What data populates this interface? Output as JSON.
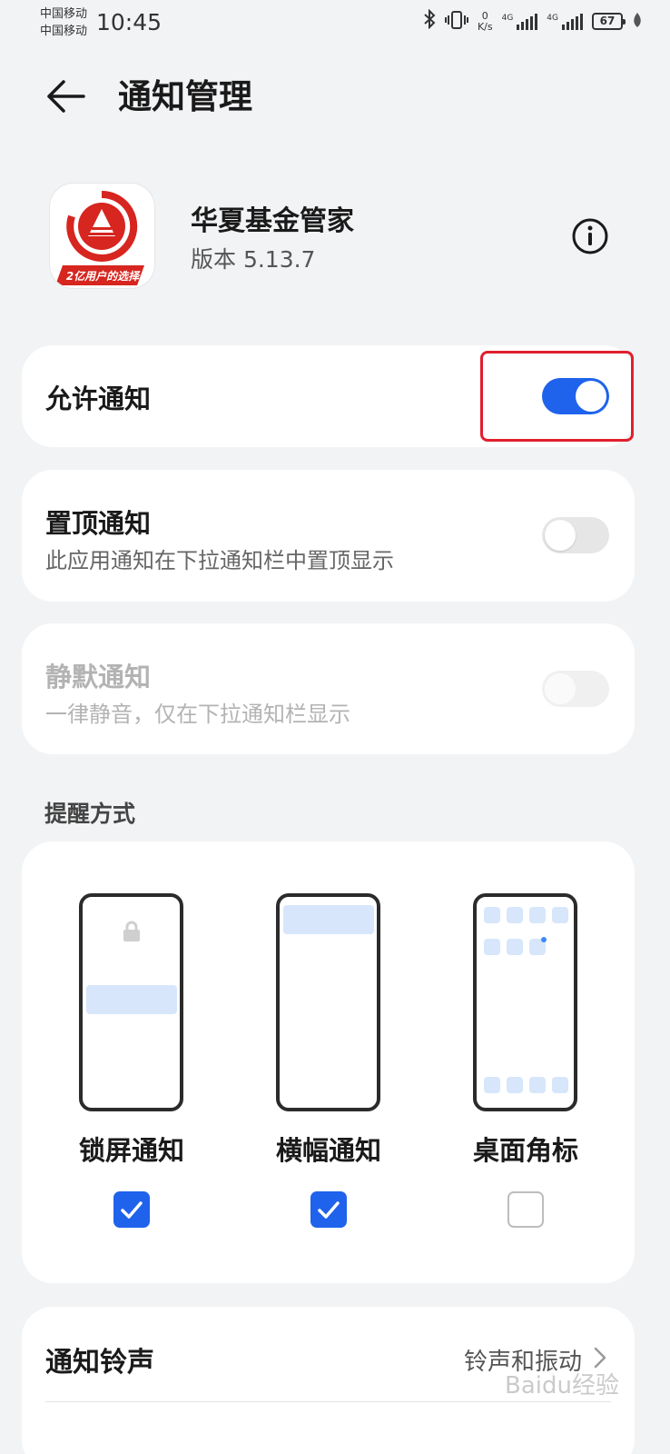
{
  "status_bar": {
    "carrier_1": "中国移动",
    "carrier_2": "中国移动",
    "time": "10:45",
    "net_speed_value": "0",
    "net_speed_unit": "K/s",
    "signal_1_label": "4G",
    "signal_2_label": "4G",
    "battery": "67"
  },
  "header": {
    "title": "通知管理",
    "back_icon": "arrow-left-icon"
  },
  "app": {
    "name": "华夏基金管家",
    "version": "版本 5.13.7",
    "icon_banner": "2亿用户的选择",
    "info_icon": "info-circle-icon",
    "brand_color": "#d7251f"
  },
  "settings": {
    "allow": {
      "title": "允许通知",
      "enabled": true
    },
    "pinned": {
      "title": "置顶通知",
      "subtitle": "此应用通知在下拉通知栏中置顶显示",
      "enabled": false
    },
    "silent": {
      "title": "静默通知",
      "subtitle": "一律静音，仅在下拉通知栏显示",
      "enabled": false,
      "disabled": true
    }
  },
  "reminder": {
    "section_label": "提醒方式",
    "options": [
      {
        "label": "锁屏通知",
        "checked": true,
        "icon": "lock-icon"
      },
      {
        "label": "横幅通知",
        "checked": true
      },
      {
        "label": "桌面角标",
        "checked": false
      }
    ]
  },
  "ringtone": {
    "title": "通知铃声",
    "value": "铃声和振动"
  },
  "watermark": "Baidu经验",
  "colors": {
    "accent": "#1f62ec",
    "highlight": "#e01f2e",
    "background": "#f1f3f5"
  }
}
